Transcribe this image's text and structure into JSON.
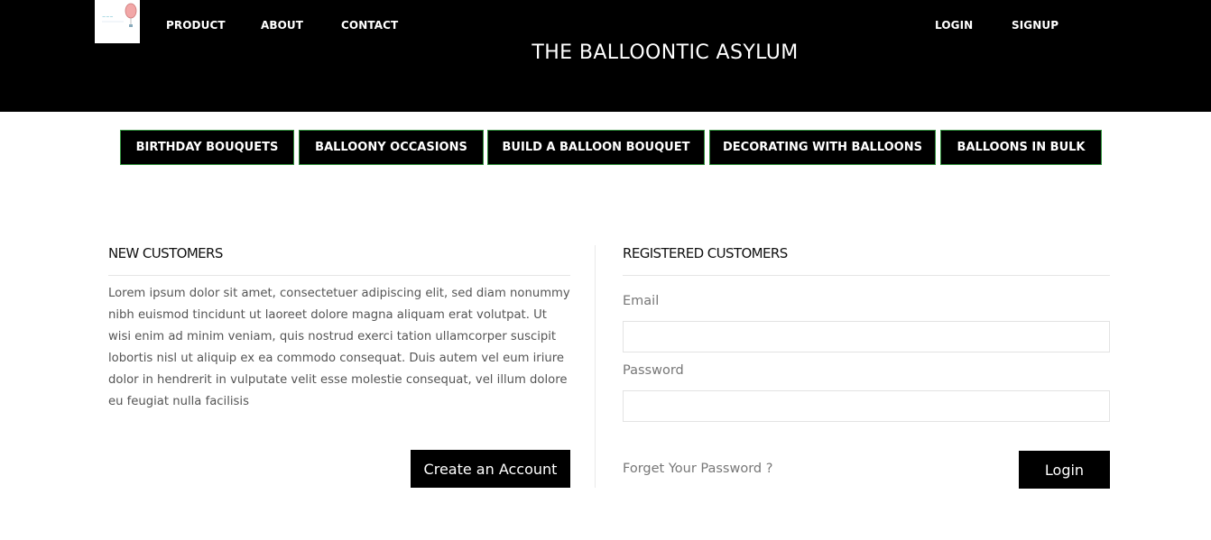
{
  "header": {
    "logo_alt": "balloon logo",
    "nav_left": [
      "PRODUCT",
      "ABOUT",
      "CONTACT"
    ],
    "nav_right": [
      "LOGIN",
      "SIGNUP"
    ],
    "site_title": "THE BALLOONTIC ASYLUM"
  },
  "categories": [
    "BIRTHDAY BOUQUETS",
    "BALLOONY OCCASIONS",
    "BUILD A BALLOON BOUQUET",
    "DECORATING WITH BALLOONS",
    "BALLOONS IN BULK"
  ],
  "new_customers": {
    "title": "NEW CUSTOMERS",
    "text": "Lorem ipsum dolor sit amet, consectetuer adipiscing elit, sed diam nonummy nibh euismod tincidunt ut laoreet dolore magna aliquam erat volutpat. Ut wisi enim ad minim veniam, quis nostrud exerci tation ullamcorper suscipit lobortis nisl ut aliquip ex ea commodo consequat. Duis autem vel eum iriure dolor in hendrerit in vulputate velit esse molestie consequat, vel illum dolore eu feugiat nulla facilisis",
    "create_button": "Create an Account"
  },
  "registered_customers": {
    "title": "REGISTERED CUSTOMERS",
    "email_label": "Email",
    "email_value": "",
    "password_label": "Password",
    "password_value": "",
    "forgot_link": "Forget Your Password ?",
    "login_button": "Login"
  },
  "colors": {
    "header_bg": "#000000",
    "button_bg": "#000000",
    "category_border": "#2f8f3a"
  }
}
